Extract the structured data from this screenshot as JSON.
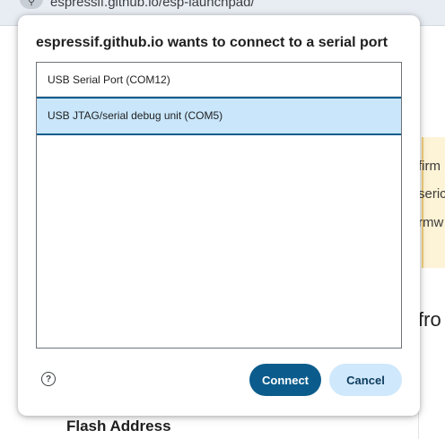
{
  "browser": {
    "url": "espressif.github.io/esp-launchpad/",
    "site_icon_glyph": "⚲"
  },
  "background": {
    "warning_lines": [
      "firm",
      "seric",
      "rmw"
    ],
    "heading_fragment": "fro",
    "flash_address_label": "Flash Address"
  },
  "dialog": {
    "title": "espressif.github.io wants to connect to a serial port",
    "ports": [
      {
        "label": "USB Serial Port (COM12)",
        "selected": false
      },
      {
        "label": "USB JTAG/serial debug unit (COM5)",
        "selected": true
      }
    ],
    "help_glyph": "?",
    "connect_label": "Connect",
    "cancel_label": "Cancel"
  },
  "colors": {
    "primary": "#0b5c8c",
    "selected_bg": "#c9e6fb",
    "cancel_bg": "#cfe8fb",
    "warning_bg": "#fdf3d6"
  }
}
